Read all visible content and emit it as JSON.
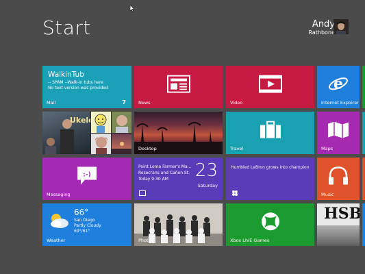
{
  "header": {
    "title": "Start"
  },
  "user": {
    "name": "Andy",
    "surname": "Rathbone"
  },
  "tiles": {
    "mail": {
      "label": "Mail",
      "from": "WalkinTub",
      "line1": "-- SPAM --Walk-in tubs here",
      "line2": "No text version was provided",
      "count": "7",
      "color": "#1ba1b7"
    },
    "news": {
      "label": "News",
      "color": "#c71a42"
    },
    "video": {
      "label": "Video",
      "color": "#c71a42"
    },
    "ie": {
      "label": "Internet Explorer",
      "color": "#1e7fdc"
    },
    "desktop": {
      "label": "Desktop"
    },
    "travel": {
      "label": "Travel",
      "color": "#1aa1b1"
    },
    "maps": {
      "label": "Maps",
      "color": "#a52ab0"
    },
    "messaging": {
      "label": "Messaging",
      "color": "#a32ab2"
    },
    "calendar": {
      "event": "Point Loma Farmer's Ma... Rosecrans and Cañon St. Today 9:30 AM",
      "event_line1": "Point Loma Farmer's Ma...",
      "event_line2": "Rosecrans and Cañon St.",
      "event_line3": "Today 9:30 AM",
      "date": "23",
      "day": "Saturday",
      "color": "#5a3bb8"
    },
    "news_story": {
      "headline": "Humbled LeBron grows into champion",
      "color": "#5a3bb8"
    },
    "music": {
      "label": "Music",
      "color": "#e0522a"
    },
    "weather": {
      "label": "Weather",
      "temp": "66°",
      "city": "San Diego",
      "condition": "Partly Cloudy",
      "range": "69°/61°",
      "color": "#1e7fdc"
    },
    "photos": {
      "label": "Photos"
    },
    "xbox": {
      "label": "Xbox LIVE Games",
      "color": "#1a9a2f"
    },
    "hsbc": {
      "brand": "HSBC"
    }
  },
  "icons": [
    "news-icon",
    "video-icon",
    "ie-icon",
    "suitcase-icon",
    "maps-icon",
    "messaging-icon",
    "headphones-icon",
    "xbox-icon",
    "calendar-icon",
    "weather-icon"
  ]
}
